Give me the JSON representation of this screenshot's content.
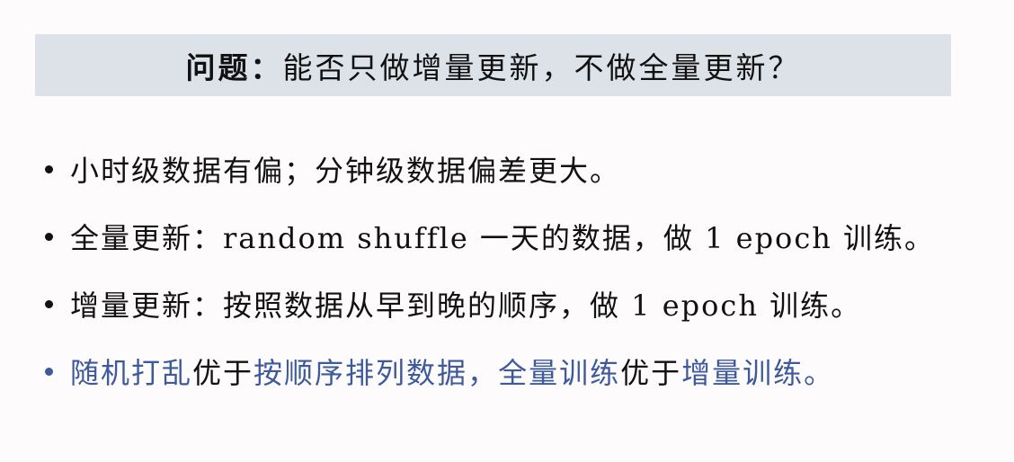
{
  "title": {
    "label": "问题：",
    "question": "能否只做增量更新，不做全量更新？"
  },
  "bullets": [
    {
      "text": "小时级数据有偏；分钟级数据偏差更大。"
    },
    {
      "text": "全量更新：random shuffle 一天的数据，做 1 epoch 训练。"
    },
    {
      "text": "增量更新：按照数据从早到晚的顺序，做 1 epoch 训练。"
    }
  ],
  "conclusion": {
    "part1": "随机打乱",
    "part2": "优于",
    "part3": "按顺序排列数据",
    "part4": "，",
    "part5": "全量训练",
    "part6": "优于",
    "part7": "增量训练",
    "part8": "。"
  },
  "colors": {
    "accent": "#3d5a9a",
    "title_background": "#dde1e8",
    "text": "#111111"
  }
}
